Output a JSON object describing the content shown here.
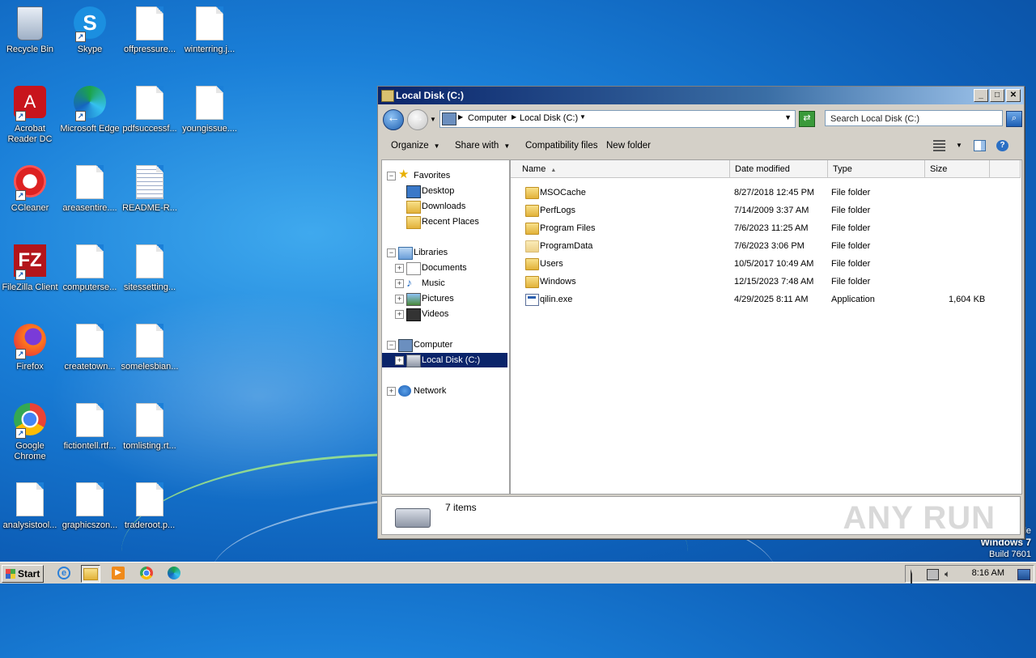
{
  "desktop": {
    "icons": [
      {
        "label": "Recycle Bin"
      },
      {
        "label": "Skype"
      },
      {
        "label": "offpressure..."
      },
      {
        "label": "winterring.j..."
      },
      {
        "label": "Acrobat Reader DC"
      },
      {
        "label": "Microsoft Edge"
      },
      {
        "label": "pdfsuccessf..."
      },
      {
        "label": "youngissue...."
      },
      {
        "label": "CCleaner"
      },
      {
        "label": "areasentire...."
      },
      {
        "label": "README-R..."
      },
      {
        "label": "FileZilla Client"
      },
      {
        "label": "computerse..."
      },
      {
        "label": "sitessetting..."
      },
      {
        "label": "Firefox"
      },
      {
        "label": "createtown..."
      },
      {
        "label": "somelesbian..."
      },
      {
        "label": "Google Chrome"
      },
      {
        "label": "fictiontell.rtf..."
      },
      {
        "label": "tomlisting.rt..."
      },
      {
        "label": "analysistool..."
      },
      {
        "label": "graphicszon..."
      },
      {
        "label": "traderoot.p..."
      }
    ],
    "branding": {
      "line1": "le",
      "line2": "Windows 7",
      "line3": "Build 7601"
    }
  },
  "window": {
    "title": "Local Disk (C:)",
    "address": {
      "crumbs": [
        "Computer",
        "Local Disk (C:)"
      ]
    },
    "search_placeholder": "Search Local Disk (C:)",
    "toolbar": {
      "organize": "Organize",
      "share": "Share with",
      "compat": "Compatibility files",
      "new_folder": "New folder"
    },
    "nav": {
      "favorites": "Favorites",
      "desktop": "Desktop",
      "downloads": "Downloads",
      "recent": "Recent Places",
      "libraries": "Libraries",
      "documents": "Documents",
      "music": "Music",
      "pictures": "Pictures",
      "videos": "Videos",
      "computer": "Computer",
      "localdisk": "Local Disk (C:)",
      "network": "Network"
    },
    "columns": {
      "name": "Name",
      "date": "Date modified",
      "type": "Type",
      "size": "Size"
    },
    "files": [
      {
        "name": "MSOCache",
        "date": "8/27/2018 12:45 PM",
        "type": "File folder",
        "size": "",
        "kind": "folder"
      },
      {
        "name": "PerfLogs",
        "date": "7/14/2009 3:37 AM",
        "type": "File folder",
        "size": "",
        "kind": "folder"
      },
      {
        "name": "Program Files",
        "date": "7/6/2023 11:25 AM",
        "type": "File folder",
        "size": "",
        "kind": "folder"
      },
      {
        "name": "ProgramData",
        "date": "7/6/2023 3:06 PM",
        "type": "File folder",
        "size": "",
        "kind": "folder"
      },
      {
        "name": "Users",
        "date": "10/5/2017 10:49 AM",
        "type": "File folder",
        "size": "",
        "kind": "folder"
      },
      {
        "name": "Windows",
        "date": "12/15/2023 7:48 AM",
        "type": "File folder",
        "size": "",
        "kind": "folder"
      },
      {
        "name": "qilin.exe",
        "date": "4/29/2025 8:11 AM",
        "type": "Application",
        "size": "1,604 KB",
        "kind": "exe"
      }
    ],
    "status": {
      "count": "7 items",
      "watermark": "ANY RUN"
    }
  },
  "taskbar": {
    "start": "Start",
    "clock": "8:16 AM"
  }
}
